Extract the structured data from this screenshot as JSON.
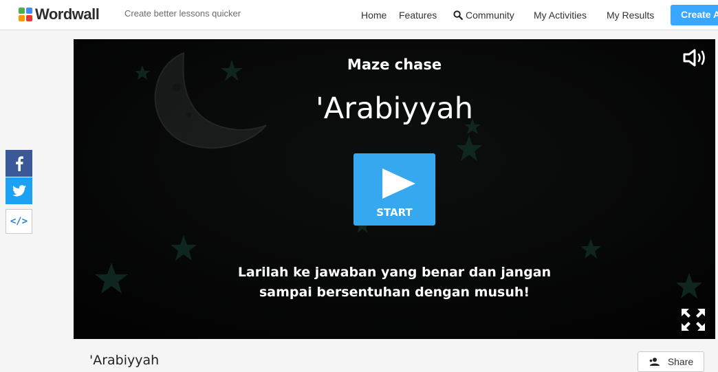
{
  "header": {
    "brand": "Wordwall",
    "tagline": "Create better lessons quicker",
    "nav": {
      "home": "Home",
      "features": "Features",
      "community": "Community",
      "my_activities": "My Activities",
      "my_results": "My Results"
    },
    "create_label": "Create A",
    "logo_colors": [
      "#4caf50",
      "#3f8efc",
      "#ff9800",
      "#e53935"
    ]
  },
  "sidebar": {
    "facebook_icon": "facebook-icon",
    "twitter_icon": "twitter-icon",
    "embed_glyph": "</>"
  },
  "game": {
    "type_label": "Maze chase",
    "title": "'Arabiyyah",
    "start_label": "START",
    "instructions_line1": "Larilah ke jawaban yang benar dan jangan",
    "instructions_line2": "sampai bersentuhan dengan musuh!",
    "accent": "#35a8f0"
  },
  "activity": {
    "title": "'Arabiyyah",
    "share_label": "Share"
  }
}
